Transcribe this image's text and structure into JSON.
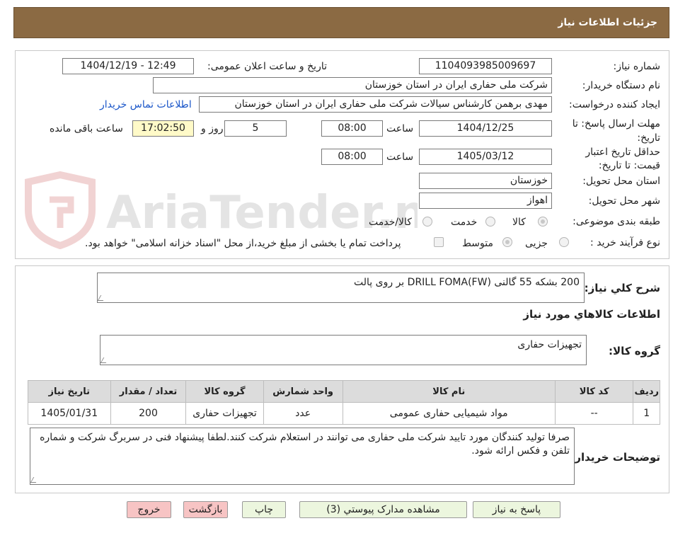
{
  "header": {
    "title": "جزئیات اطلاعات نیاز"
  },
  "watermark": {
    "text": "AriaTender.neT"
  },
  "form": {
    "need_number_label": "شماره نیاز:",
    "need_number": "1104093985009697",
    "announce_label": "تاریخ و ساعت اعلان عمومی:",
    "announce_value": "1404/12/19 - 12:49",
    "buyer_label": "نام دستگاه خریدار:",
    "buyer_value": "شرکت ملی حفاری ایران در استان خوزستان",
    "creator_label": "ایجاد کننده درخواست:",
    "creator_value": "مهدی برهمن کارشناس سیالات شرکت ملی حفاری ایران در استان خوزستان",
    "contact_link": "اطلاعات تماس خریدار",
    "deadline_label": "مهلت ارسال پاسخ: تا تاریخ:",
    "deadline_date": "1404/12/25",
    "time_label": "ساعت",
    "deadline_time": "08:00",
    "days_value": "5",
    "days_label": "روز و",
    "remaining_time": "17:02:50",
    "remaining_label": "ساعت باقی مانده",
    "validity_label": "حداقل تاریخ اعتبار قیمت: تا تاریخ:",
    "validity_date": "1405/03/12",
    "validity_time": "08:00",
    "province_label": "استان محل تحویل:",
    "province_value": "خوزستان",
    "city_label": "شهر محل تحویل:",
    "city_value": "اهواز",
    "category_label": "طبقه بندی موضوعی:",
    "category_options": [
      "کالا",
      "خدمت",
      "کالا/خدمت"
    ],
    "process_label": "نوع فرآیند خرید :",
    "process_options": [
      "جزیی",
      "متوسط"
    ],
    "payment_note": "پرداخت تمام یا بخشی از مبلغ خرید،از محل \"اسناد خزانه اسلامی\" خواهد بود."
  },
  "details": {
    "summary_label": "شرح کلي نياز:",
    "summary_value": "200 بشکه 55 گالنی DRILL FOMA(FW) بر روی پالت",
    "goods_info_title": "اطلاعات کالاهاي مورد نياز",
    "goods_group_label": "گروه کالا:",
    "goods_group_value": "تجهیزات حفاری",
    "table": {
      "headers": [
        "ردیف",
        "کد کالا",
        "نام کالا",
        "واحد شمارش",
        "گروه کالا",
        "تعداد / مقدار",
        "تاریخ نیاز"
      ],
      "rows": [
        [
          "1",
          "--",
          "مواد شیمیایی حفاری عمومی",
          "عدد",
          "تجهیزات حفاری",
          "200",
          "1405/01/31"
        ]
      ]
    },
    "buyer_notes_label": "توضیحات خریدار:",
    "buyer_notes_value": "صرفا تولید کنندگان مورد تایید شرکت ملی حفاری می توانند در استعلام شرکت کنند.لطفا پیشنهاد فنی در سربرگ شرکت و شماره تلفن و فکس ارائه شود."
  },
  "buttons": {
    "reply": "پاسخ به نیاز",
    "view_docs": "مشاهده مدارک پیوستي (3)",
    "print": "چاپ",
    "back": "بازگشت",
    "exit": "خروج"
  }
}
